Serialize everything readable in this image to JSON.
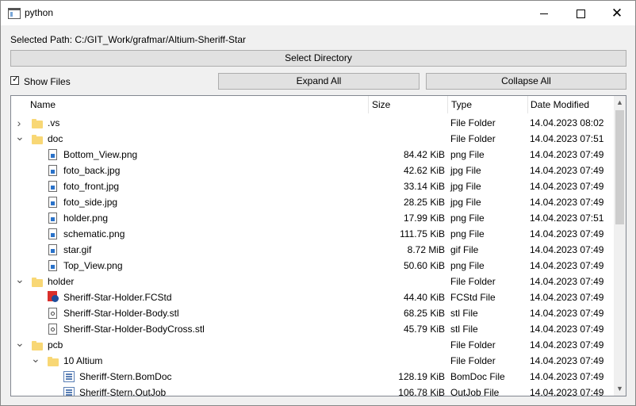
{
  "window": {
    "title": "python",
    "app_icon": "python-window-icon"
  },
  "titlebar_buttons": {
    "minimize": "minimize-icon",
    "maximize": "maximize-icon",
    "close": "close-icon"
  },
  "selected_path": "Selected Path: C:/GIT_Work/grafmar/Altium-Sheriff-Star",
  "buttons": {
    "select_directory": "Select Directory",
    "expand_all": "Expand All",
    "collapse_all": "Collapse All"
  },
  "show_files": {
    "label": "Show Files",
    "checked": true
  },
  "tree": {
    "columns": [
      "Name",
      "Size",
      "Type",
      "Date Modified"
    ],
    "rows": [
      {
        "name": ".vs",
        "size": "",
        "type": "File Folder",
        "date": "14.04.2023 08:02",
        "level": 0,
        "expander": "collapsed",
        "icon": "folder-icon"
      },
      {
        "name": "doc",
        "size": "",
        "type": "File Folder",
        "date": "14.04.2023 07:51",
        "level": 0,
        "expander": "expanded",
        "icon": "folder-icon"
      },
      {
        "name": "Bottom_View.png",
        "size": "84.42 KiB",
        "type": "png File",
        "date": "14.04.2023 07:49",
        "level": 1,
        "expander": "none",
        "icon": "image-file-icon"
      },
      {
        "name": "foto_back.jpg",
        "size": "42.62 KiB",
        "type": "jpg File",
        "date": "14.04.2023 07:49",
        "level": 1,
        "expander": "none",
        "icon": "image-file-icon"
      },
      {
        "name": "foto_front.jpg",
        "size": "33.14 KiB",
        "type": "jpg File",
        "date": "14.04.2023 07:49",
        "level": 1,
        "expander": "none",
        "icon": "image-file-icon"
      },
      {
        "name": "foto_side.jpg",
        "size": "28.25 KiB",
        "type": "jpg File",
        "date": "14.04.2023 07:49",
        "level": 1,
        "expander": "none",
        "icon": "image-file-icon"
      },
      {
        "name": "holder.png",
        "size": "17.99 KiB",
        "type": "png File",
        "date": "14.04.2023 07:51",
        "level": 1,
        "expander": "none",
        "icon": "image-file-icon"
      },
      {
        "name": "schematic.png",
        "size": "111.75 KiB",
        "type": "png File",
        "date": "14.04.2023 07:49",
        "level": 1,
        "expander": "none",
        "icon": "image-file-icon"
      },
      {
        "name": "star.gif",
        "size": "8.72 MiB",
        "type": "gif File",
        "date": "14.04.2023 07:49",
        "level": 1,
        "expander": "none",
        "icon": "image-file-icon"
      },
      {
        "name": "Top_View.png",
        "size": "50.60 KiB",
        "type": "png File",
        "date": "14.04.2023 07:49",
        "level": 1,
        "expander": "none",
        "icon": "image-file-icon"
      },
      {
        "name": "holder",
        "size": "",
        "type": "File Folder",
        "date": "14.04.2023 07:49",
        "level": 0,
        "expander": "expanded",
        "icon": "folder-icon"
      },
      {
        "name": "Sheriff-Star-Holder.FCStd",
        "size": "44.40 KiB",
        "type": "FCStd File",
        "date": "14.04.2023 07:49",
        "level": 1,
        "expander": "none",
        "icon": "freecad-file-icon"
      },
      {
        "name": "Sheriff-Star-Holder-Body.stl",
        "size": "68.25 KiB",
        "type": "stl File",
        "date": "14.04.2023 07:49",
        "level": 1,
        "expander": "none",
        "icon": "stl-file-icon"
      },
      {
        "name": "Sheriff-Star-Holder-BodyCross.stl",
        "size": "45.79 KiB",
        "type": "stl File",
        "date": "14.04.2023 07:49",
        "level": 1,
        "expander": "none",
        "icon": "stl-file-icon"
      },
      {
        "name": "pcb",
        "size": "",
        "type": "File Folder",
        "date": "14.04.2023 07:49",
        "level": 0,
        "expander": "expanded",
        "icon": "folder-icon"
      },
      {
        "name": "10 Altium",
        "size": "",
        "type": "File Folder",
        "date": "14.04.2023 07:49",
        "level": 1,
        "expander": "expanded",
        "icon": "folder-icon"
      },
      {
        "name": "Sheriff-Stern.BomDoc",
        "size": "128.19 KiB",
        "type": "BomDoc File",
        "date": "14.04.2023 07:49",
        "level": 2,
        "expander": "none",
        "icon": "altium-file-icon"
      },
      {
        "name": "Sheriff-Stern.OutJob",
        "size": "106.78 KiB",
        "type": "OutJob File",
        "date": "14.04.2023 07:49",
        "level": 2,
        "expander": "none",
        "icon": "altium-file-icon"
      }
    ]
  },
  "scrollbar": {
    "position": 0.0,
    "visible_fraction": 0.42
  }
}
